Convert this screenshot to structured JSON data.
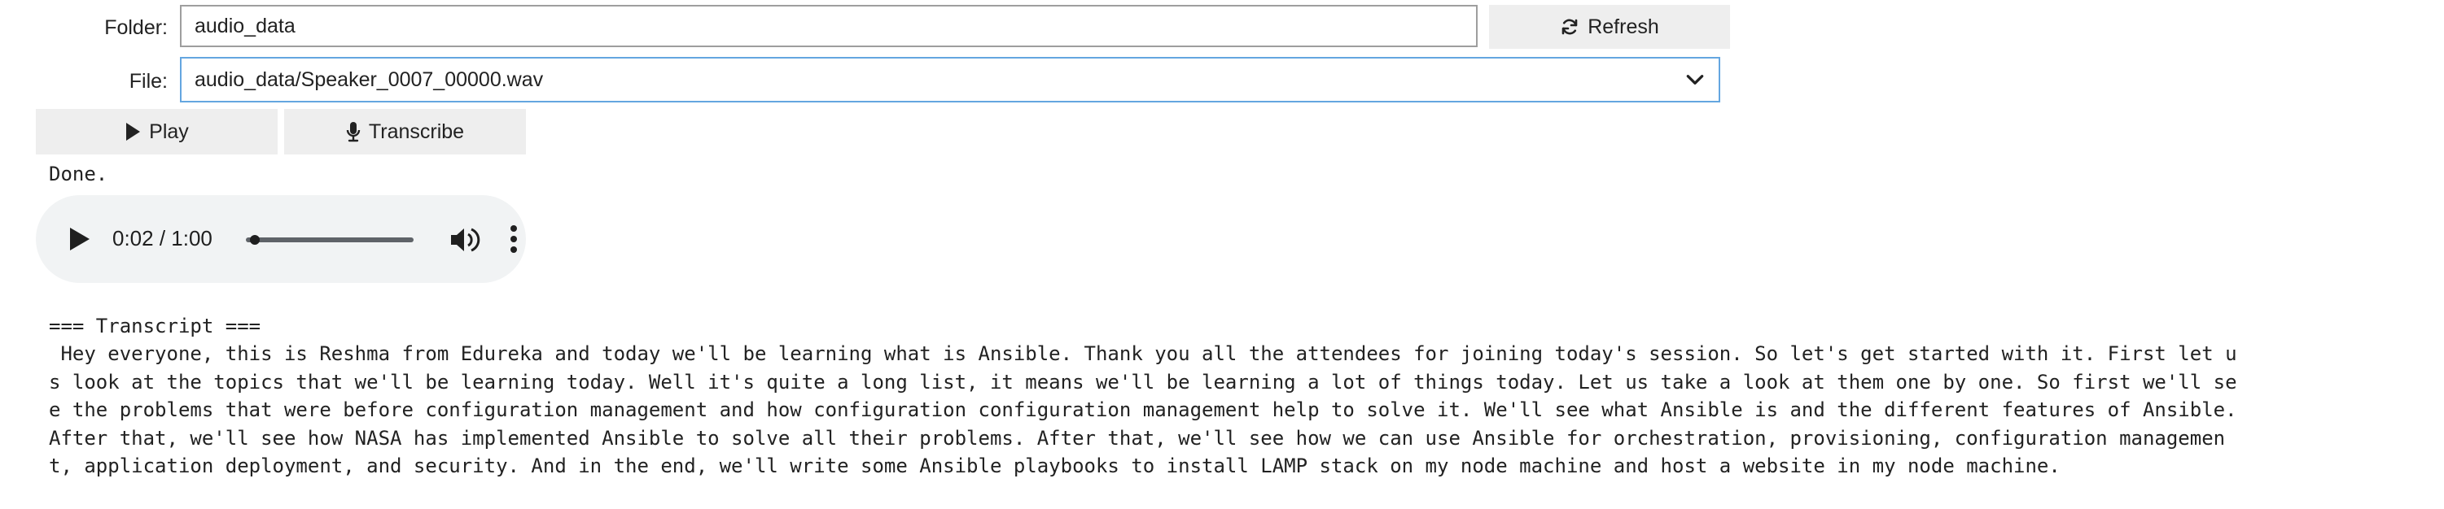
{
  "folder": {
    "label": "Folder:",
    "value": "audio_data",
    "refresh_label": "Refresh"
  },
  "file": {
    "label": "File:",
    "selected": "audio_data/Speaker_0007_00000.wav"
  },
  "actions": {
    "play_label": "Play",
    "transcribe_label": "Transcribe"
  },
  "status": "Done.",
  "player": {
    "time": "0:02 / 1:00",
    "progress": 0.033
  },
  "transcript": {
    "heading": "=== Transcript ===",
    "lines": [
      " Hey everyone, this is Reshma from Edureka and today we'll be learning what is Ansible. Thank you all the attendees for joining today's session. So let's get started with it. First let u",
      "s look at the topics that we'll be learning today. Well it's quite a long list, it means we'll be learning a lot of things today. Let us take a look at them one by one. So first we'll se",
      "e the problems that were before configuration management and how configuration configuration management help to solve it. We'll see what Ansible is and the different features of Ansible.",
      "After that, we'll see how NASA has implemented Ansible to solve all their problems. After that, we'll see how we can use Ansible for orchestration, provisioning, configuration managemen",
      "t, application deployment, and security. And in the end, we'll write some Ansible playbooks to install LAMP stack on my node machine and host a website in my node machine."
    ]
  },
  "icons": {
    "refresh": "refresh-icon",
    "chevron": "chevron-down-icon",
    "play": "play-icon",
    "microphone": "microphone-icon",
    "volume": "volume-icon",
    "more": "more-vertical-icon"
  }
}
